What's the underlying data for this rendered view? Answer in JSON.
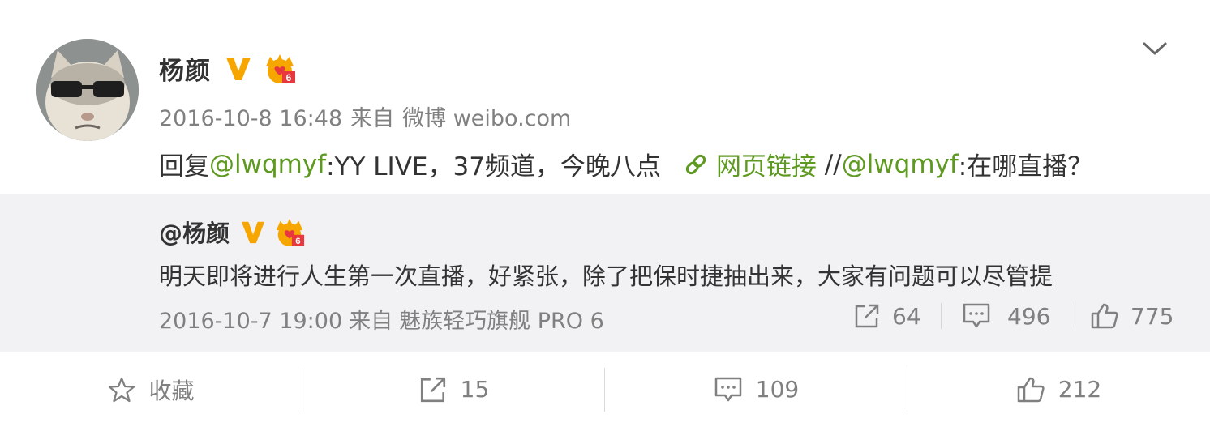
{
  "post": {
    "author": "杨颜",
    "timestamp": "2016-10-8 16:48",
    "from_label": "来自",
    "source": "微博 weibo.com",
    "text_prefix": "回复",
    "mention1": "@lwqmyf",
    "text_middle": ":YY LIVE，37频道，今晚八点",
    "weblink_label": "网页链接",
    "text_slashes": " //",
    "mention2": "@lwqmyf",
    "text_end": ":在哪直播？"
  },
  "repost": {
    "author": "@杨颜",
    "text": "明天即将进行人生第一次直播，好紧张，除了把保时捷抽出来，大家有问题可以尽管提",
    "timestamp": "2016-10-7 19:00",
    "from_label": "来自",
    "source": "魅族轻巧旗舰 PRO 6",
    "forward_count": "64",
    "comment_count": "496",
    "like_count": "775"
  },
  "actions": {
    "favorite_label": "收藏",
    "forward_count": "15",
    "comment_count": "109",
    "like_count": "212"
  },
  "icons": {
    "verified": "verified-v-icon",
    "member": "crown-member-icon",
    "link": "link-icon",
    "more": "chevron-down-icon",
    "favorite": "star-icon",
    "forward": "share-icon",
    "comment": "comment-icon",
    "like": "thumbs-up-icon"
  },
  "colors": {
    "accent_link": "#5d9a1f",
    "verified": "#f7a600",
    "repost_bg": "#f2f2f5",
    "meta_text": "#808080"
  }
}
